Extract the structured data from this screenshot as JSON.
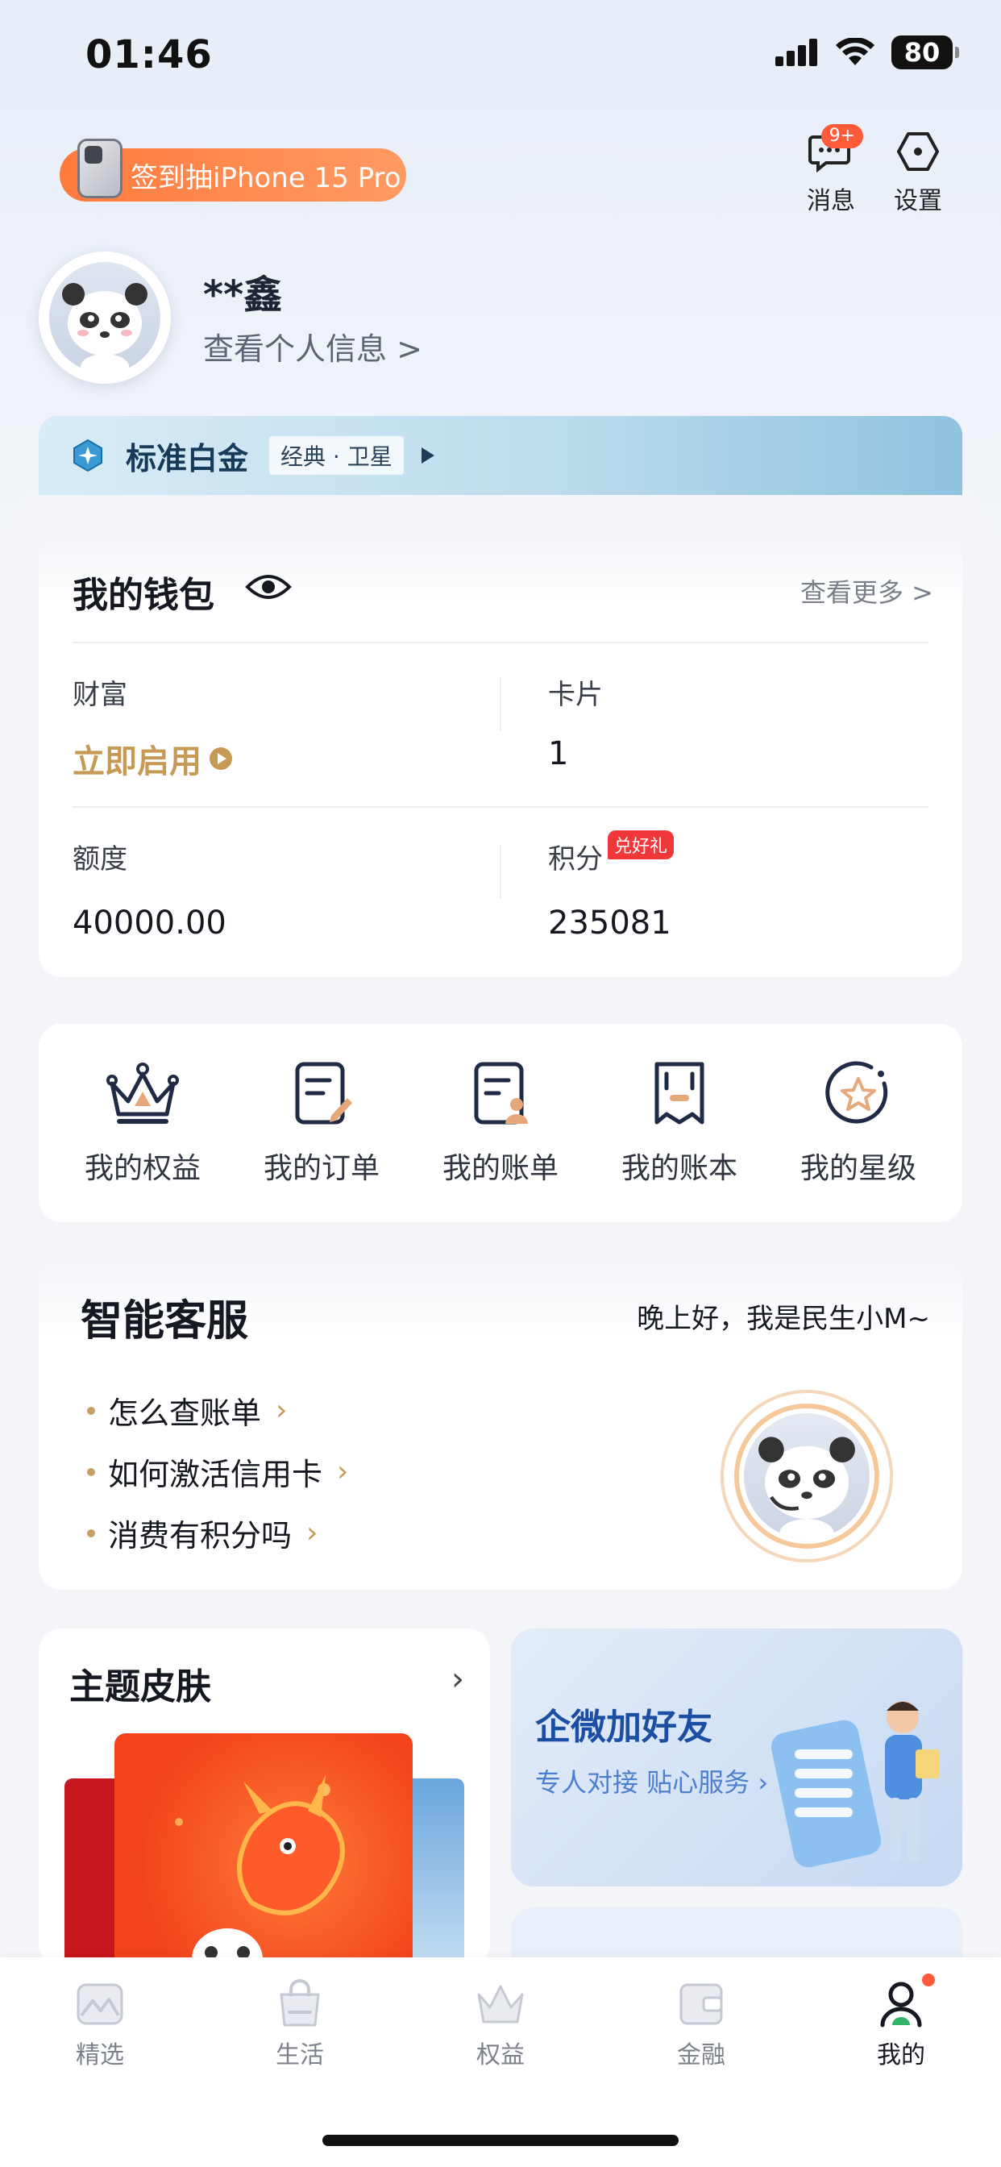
{
  "status_bar": {
    "time": "01:46",
    "battery": "80"
  },
  "promo": {
    "text": "签到抽iPhone 15 Pro"
  },
  "header": {
    "messages": {
      "label": "消息",
      "badge": "9+"
    },
    "settings": {
      "label": "设置"
    }
  },
  "profile": {
    "name": "**鑫",
    "link": "查看个人信息 >"
  },
  "level": {
    "name": "标准白金",
    "tag": "经典 · 卫星"
  },
  "wallet": {
    "title": "我的钱包",
    "more": "查看更多 >",
    "cells": [
      {
        "label": "财富",
        "value": "立即启用"
      },
      {
        "label": "卡片",
        "value": "1"
      },
      {
        "label": "额度",
        "value": "40000.00"
      },
      {
        "label": "积分",
        "value": "235081",
        "tag": "兑好礼"
      }
    ]
  },
  "quick": [
    {
      "label": "我的权益",
      "icon": "crown-icon"
    },
    {
      "label": "我的订单",
      "icon": "order-icon"
    },
    {
      "label": "我的账单",
      "icon": "bill-icon"
    },
    {
      "label": "我的账本",
      "icon": "ledger-icon"
    },
    {
      "label": "我的星级",
      "icon": "star-level-icon"
    }
  ],
  "service": {
    "title": "智能客服",
    "greeting": "晚上好，我是民生小M~",
    "faqs": [
      "怎么查账单",
      "如何激活信用卡",
      "消费有积分吗"
    ]
  },
  "theme": {
    "title": "主题皮肤"
  },
  "wechat": {
    "title": "企微加好友",
    "subtitle": "专人对接 贴心服务"
  },
  "tabs": [
    {
      "label": "精选",
      "icon": "mountain-icon"
    },
    {
      "label": "生活",
      "icon": "shopping-bag-icon"
    },
    {
      "label": "权益",
      "icon": "crown-icon"
    },
    {
      "label": "金融",
      "icon": "wallet-icon"
    },
    {
      "label": "我的",
      "icon": "person-icon",
      "active": true
    }
  ],
  "colors": {
    "accent_gold": "#c69a55",
    "promo_orange": "#ff7a3d",
    "badge_red": "#ff5b3a",
    "level_blue": "#163a5a"
  }
}
